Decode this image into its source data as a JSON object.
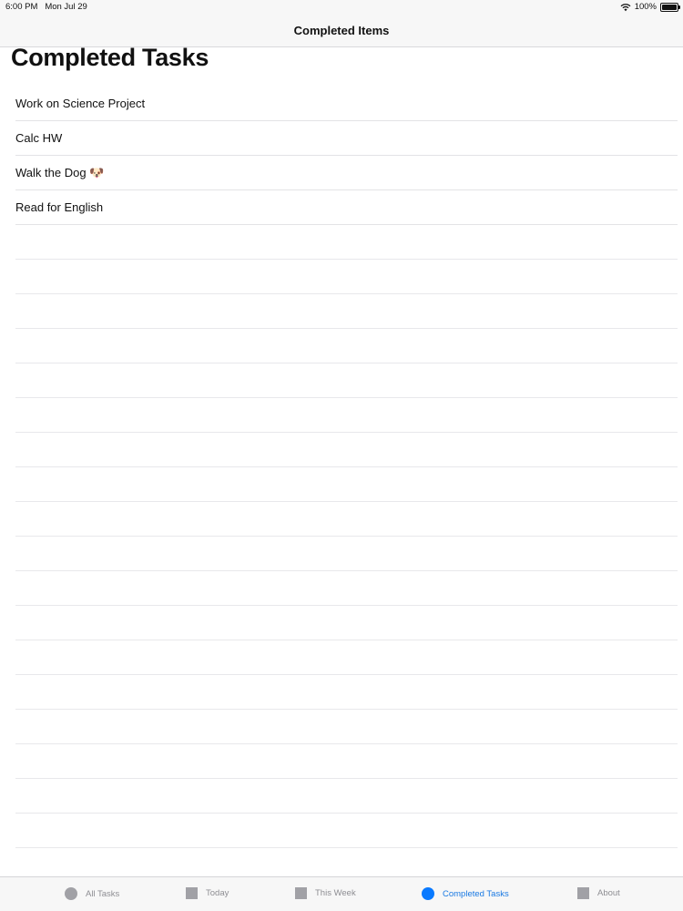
{
  "status_bar": {
    "time": "6:00 PM",
    "date": "Mon Jul 29",
    "battery": "100%"
  },
  "nav": {
    "title": "Completed Items"
  },
  "page": {
    "title": "Completed Tasks"
  },
  "tasks": [
    {
      "label": "Work on Science Project"
    },
    {
      "label": "Calc HW"
    },
    {
      "label": "Walk the Dog 🐶"
    },
    {
      "label": "Read for English"
    }
  ],
  "tab_bar": {
    "tabs": [
      {
        "label": "All Tasks",
        "icon": "circle-icon",
        "active": false
      },
      {
        "label": "Today",
        "icon": "square-icon",
        "active": false
      },
      {
        "label": "This Week",
        "icon": "square-icon",
        "active": false
      },
      {
        "label": "Completed Tasks",
        "icon": "circle-icon",
        "active": true
      },
      {
        "label": "About",
        "icon": "square-icon",
        "active": false
      }
    ],
    "active_color": "#1B7AE3",
    "inactive_color": "#8E8E93"
  }
}
